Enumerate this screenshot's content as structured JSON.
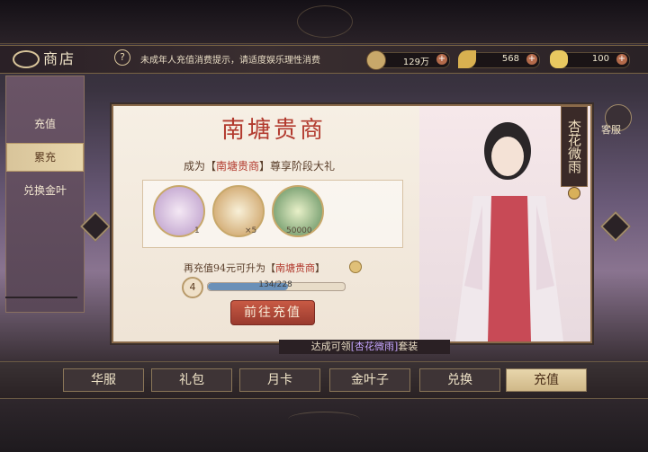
{
  "header": {
    "title": "商店",
    "notice": "未成年人充值消费提示，请适度娱乐理性消费"
  },
  "currencies": [
    {
      "name": "copper-coin",
      "value": "129万"
    },
    {
      "name": "gold-leaf",
      "value": "568"
    },
    {
      "name": "ingot",
      "value": "100"
    }
  ],
  "sidebar": {
    "items": [
      {
        "label": "充值"
      },
      {
        "label": "累充"
      },
      {
        "label": "兑换金叶"
      }
    ],
    "active": "累充"
  },
  "customer_service": "客服",
  "panel": {
    "title": "南塘贵商",
    "subtitle_pre": "成为【",
    "subtitle_hl": "南塘贵商",
    "subtitle_post": "】尊享阶段大礼",
    "items": [
      {
        "name": "costume",
        "count": "1"
      },
      {
        "name": "orb",
        "count": "×5"
      },
      {
        "name": "coin",
        "count": "50000"
      }
    ],
    "upgrade_pre": "再充值94元可升为【",
    "upgrade_hl": "南塘贵商",
    "upgrade_post": "】",
    "level": "4",
    "progress_text": "134/228",
    "progress": 0.5877,
    "go_button": "前往充值",
    "character_name": "杏花微雨"
  },
  "reward": {
    "pre": "达成可领",
    "hl": "[杏花微雨]",
    "post": "套装"
  },
  "tabs": [
    {
      "label": "华服"
    },
    {
      "label": "礼包"
    },
    {
      "label": "月卡"
    },
    {
      "label": "金叶子"
    },
    {
      "label": "兑换"
    },
    {
      "label": "充值"
    }
  ],
  "active_tab": "充值",
  "colors": {
    "accent": "#b23a2e",
    "gold": "#d8c49a",
    "progress": "#6a90b8"
  }
}
